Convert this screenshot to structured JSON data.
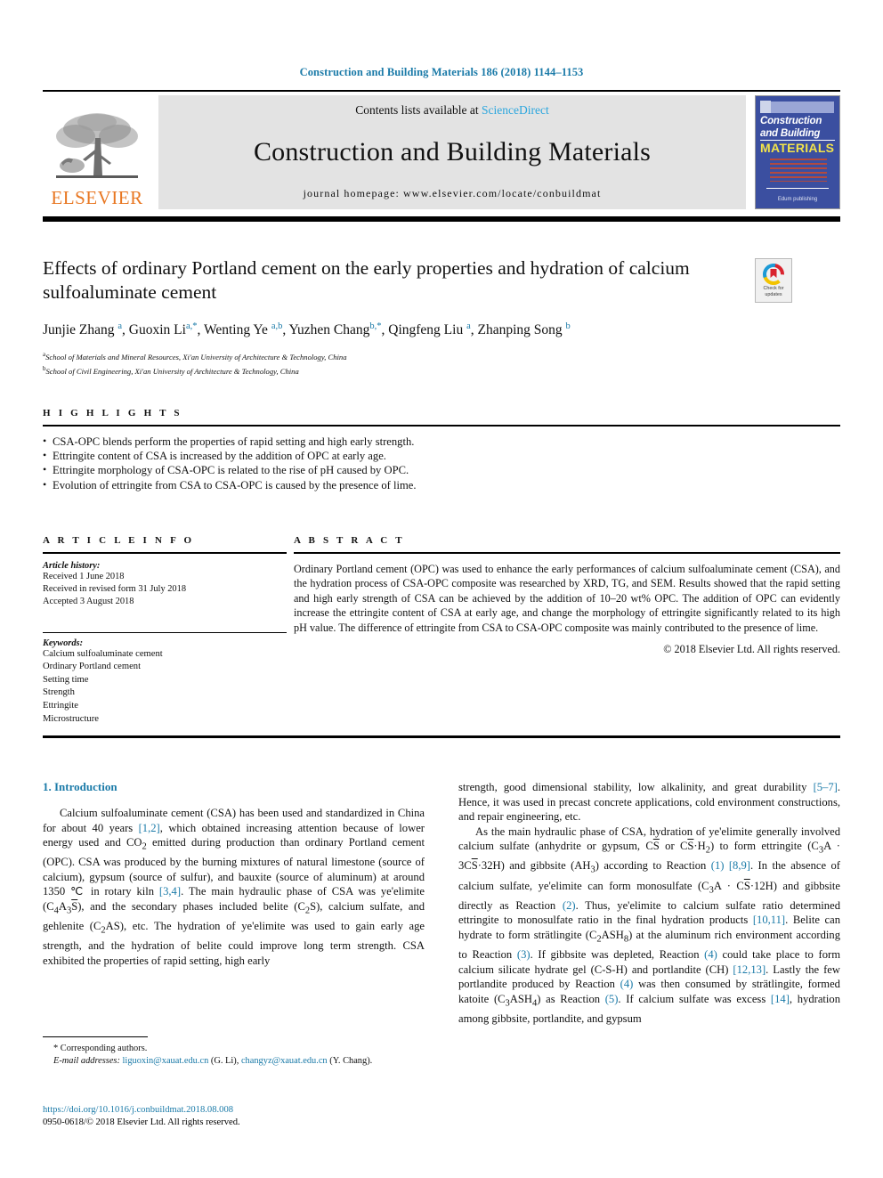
{
  "running_head": "Construction and Building Materials 186 (2018) 1144–1153",
  "masthead": {
    "publisher_name": "ELSEVIER",
    "contents_prefix": "Contents lists available at ",
    "contents_link": "ScienceDirect",
    "journal_name": "Construction and Building Materials",
    "homepage_line": "journal homepage: www.elsevier.com/locate/conbuildmat",
    "cover": {
      "line1": "Construction",
      "line2": "and Building",
      "line3": "MATERIALS",
      "footer": "Edum publishing"
    }
  },
  "title": "Effects of ordinary Portland cement on the early properties and hydration of calcium sulfoaluminate cement",
  "crossmark": {
    "line1": "Check for",
    "line2": "updates"
  },
  "authors_html": "Junjie Zhang <sup>a</sup>, Guoxin Li<sup>a,*</sup>, Wenting Ye <sup>a,b</sup>, Yuzhen Chang<sup>b,*</sup>, Qingfeng Liu <sup>a</sup>, Zhanping Song <sup>b</sup>",
  "affiliations": [
    {
      "marker": "a",
      "text": "School of Materials and Mineral Resources, Xi'an University of Architecture & Technology, China"
    },
    {
      "marker": "b",
      "text": "School of Civil Engineering, Xi'an University of Architecture & Technology, China"
    }
  ],
  "highlights": {
    "heading": "H I G H L I G H T S",
    "items": [
      "CSA-OPC blends perform the properties of rapid setting and high early strength.",
      "Ettringite content of CSA is increased by the addition of OPC at early age.",
      "Ettringite morphology of CSA-OPC is related to the rise of pH caused by OPC.",
      "Evolution of ettringite from CSA to CSA-OPC is caused by the presence of lime."
    ]
  },
  "article_info": {
    "heading": "A R T I C L E   I N F O",
    "history_label": "Article history:",
    "history": [
      "Received 1 June 2018",
      "Received in revised form 31 July 2018",
      "Accepted 3 August 2018"
    ],
    "keywords_label": "Keywords:",
    "keywords": [
      "Calcium sulfoaluminate cement",
      "Ordinary Portland cement",
      "Setting time",
      "Strength",
      "Ettringite",
      "Microstructure"
    ]
  },
  "abstract": {
    "heading": "A B S T R A C T",
    "text": "Ordinary Portland cement (OPC) was used to enhance the early performances of calcium sulfoaluminate cement (CSA), and the hydration process of CSA-OPC composite was researched by XRD, TG, and SEM. Results showed that the rapid setting and high early strength of CSA can be achieved by the addition of 10–20 wt% OPC. The addition of OPC can evidently increase the ettringite content of CSA at early age, and change the morphology of ettringite significantly related to its high pH value. The difference of ettringite from CSA to CSA-OPC composite was mainly contributed to the presence of lime.",
    "copyright": "© 2018 Elsevier Ltd. All rights reserved."
  },
  "body": {
    "section_title": "1. Introduction",
    "left_paragraph_1_html": "Calcium sulfoaluminate cement (CSA) has been used and standardized in China for about 40 years <span class=\"ref\">[1,2]</span>, which obtained increasing attention because of lower energy used and CO<sub>2</sub> emitted during production than ordinary Portland cement (OPC). CSA was produced by the burning mixtures of natural limestone (source of calcium), gypsum (source of sulfur), and bauxite (source of aluminum) at around 1350 &#8451; in rotary kiln <span class=\"ref\">[3,4]</span>. The main hydraulic phase of CSA was ye'elimite (C<sub>4</sub>A<sub>3</sub><span class=\"ovl\">S</span>), and the secondary phases included belite (C<sub>2</sub>S), calcium sulfate, and gehlenite (C<sub>2</sub>AS), etc. The hydration of ye'elimite was used to gain early age strength, and the hydration of belite could improve long term strength. CSA exhibited the properties of rapid setting, high early",
    "right_paragraph_1_html": "strength, good dimensional stability, low alkalinity, and great durability <span class=\"ref\">[5–7]</span>. Hence, it was used in precast concrete applications, cold environment constructions, and repair engineering, etc.",
    "right_paragraph_2_html": "As the main hydraulic phase of CSA, hydration of ye'elimite generally involved calcium sulfate (anhydrite or gypsum, C<span class=\"ovl\">S</span> or C<span class=\"ovl\">S</span>&#183;H<sub>2</sub>) to form ettringite (C<sub>3</sub>A &#183; 3C<span class=\"ovl\">S</span>&#183;32H) and gibbsite (AH<sub>3</sub>) according to Reaction <span class=\"ref\">(1)</span> <span class=\"ref\">[8,9]</span>. In the absence of calcium sulfate, ye'elimite can form monosulfate (C<sub>3</sub>A &#183; C<span class=\"ovl\">S</span>&#183;12H) and gibbsite directly as Reaction <span class=\"ref\">(2)</span>. Thus, ye'elimite to calcium sulfate ratio determined ettringite to monosulfate ratio in the final hydration products <span class=\"ref\">[10,11]</span>. Belite can hydrate to form strätlingite (C<sub>2</sub>ASH<sub>8</sub>) at the aluminum rich environment according to Reaction <span class=\"ref\">(3)</span>. If gibbsite was depleted, Reaction <span class=\"ref\">(4)</span> could take place to form calcium silicate hydrate gel (C-S-H) and portlandite (CH) <span class=\"ref\">[12,13]</span>. Lastly the few portlandite produced by Reaction <span class=\"ref\">(4)</span> was then consumed by strätlingite, formed katoite (C<sub>3</sub>ASH<sub>4</sub>) as Reaction <span class=\"ref\">(5)</span>. If calcium sulfate was excess <span class=\"ref\">[14]</span>, hydration among gibbsite, portlandite, and gypsum"
  },
  "footnotes": {
    "corresponding": "* Corresponding authors.",
    "email_label": "E-mail addresses:",
    "email1": "liguoxin@xauat.edu.cn",
    "email1_owner": "(G. Li),",
    "email2": "changyz@xauat.edu.cn",
    "email2_owner": "(Y. Chang).",
    "doi": "https://doi.org/10.1016/j.conbuildmat.2018.08.008",
    "issn_line": "0950-0618/© 2018 Elsevier Ltd. All rights reserved."
  }
}
